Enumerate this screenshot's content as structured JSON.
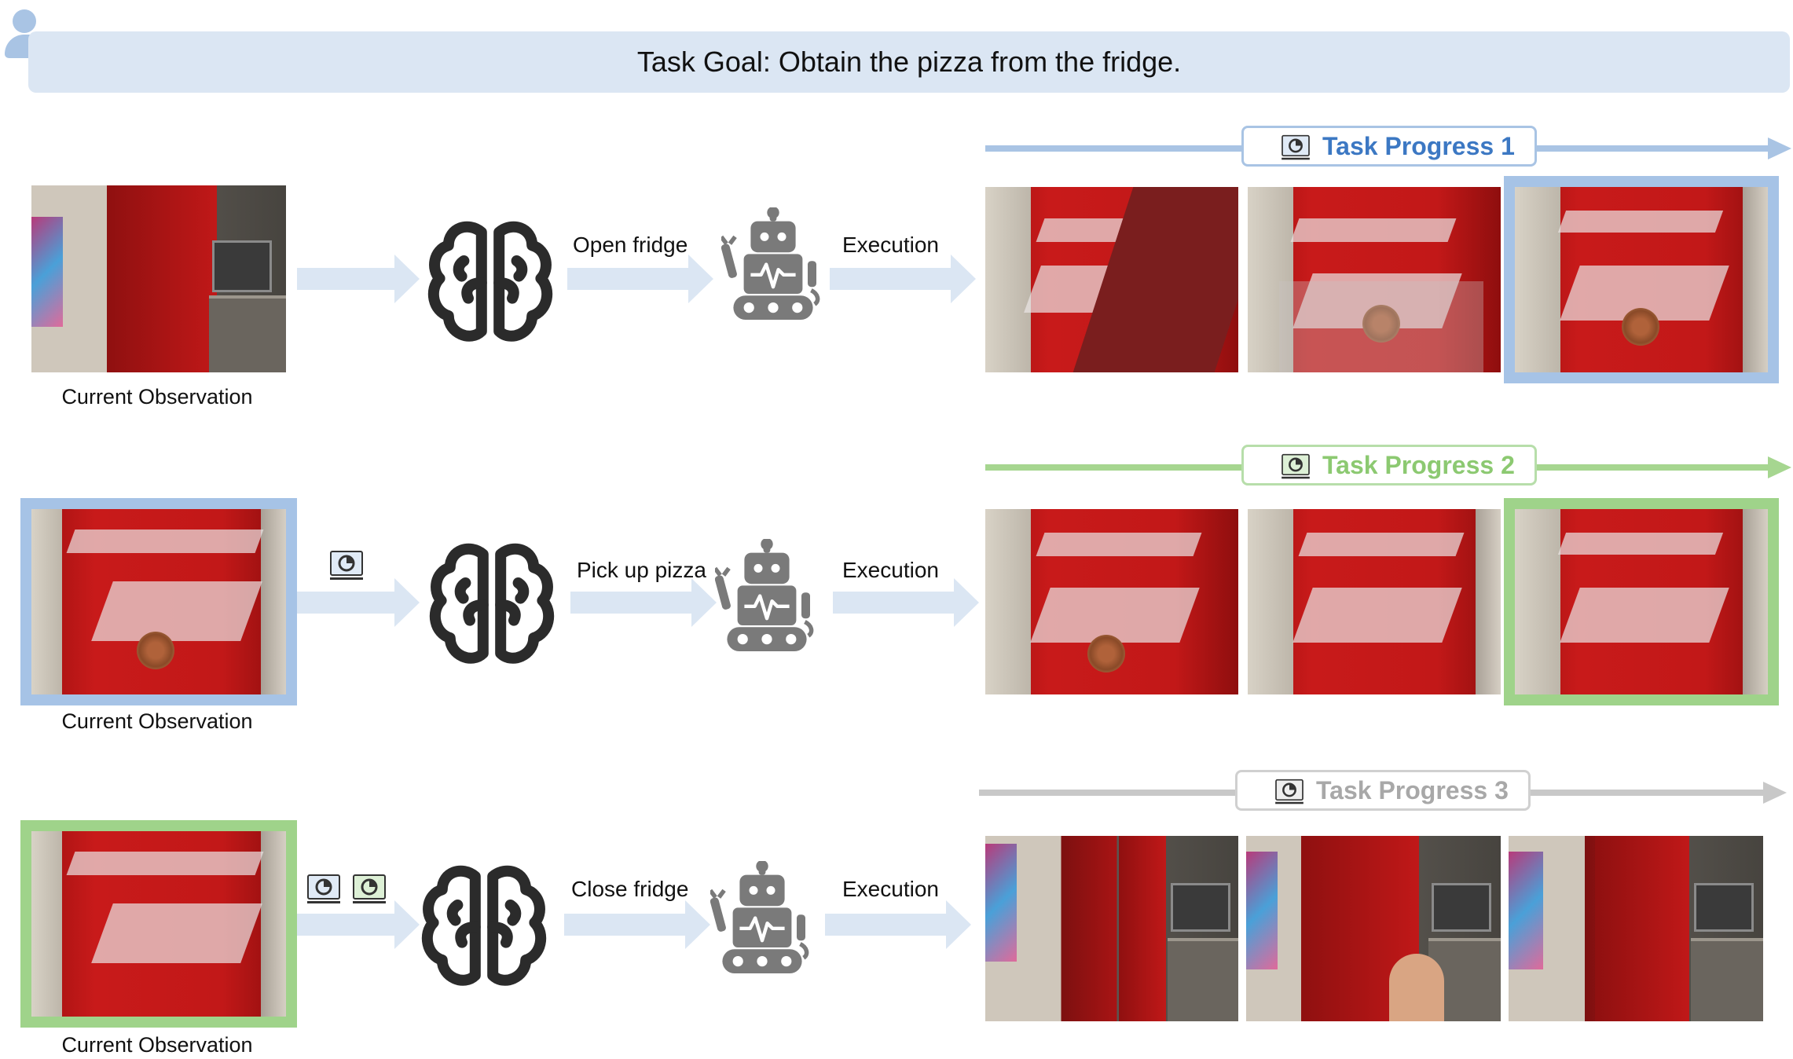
{
  "goal": "Task Goal: Obtain the pizza from the fridge.",
  "rows": [
    {
      "observation_label": "Current Observation",
      "action": "Open fridge",
      "execution": "Execution",
      "progress": "Task Progress 1",
      "progress_color": "#5b8fcf",
      "line_color": "#a9c4e4"
    },
    {
      "observation_label": "Current Observation",
      "action": "Pick up pizza",
      "execution": "Execution",
      "progress": "Task Progress 2",
      "progress_color": "#8cc971",
      "line_color": "#a6d690"
    },
    {
      "observation_label": "Current Observation",
      "action": "Close fridge",
      "execution": "Execution",
      "progress": "Task Progress 3",
      "progress_color": "#a8a8a8",
      "line_color": "#c8c8c8"
    }
  ],
  "icons": [
    "user-icon",
    "brain-icon",
    "robot-icon",
    "progress-monitor-icon"
  ],
  "colors": {
    "banner": "#dbe6f3",
    "arrow": "#dbe6f3",
    "blue": "#a6c3e6",
    "green": "#9fd38a",
    "gray": "#c8c8c8",
    "icon": "#333333",
    "robot": "#7a7a7a"
  }
}
